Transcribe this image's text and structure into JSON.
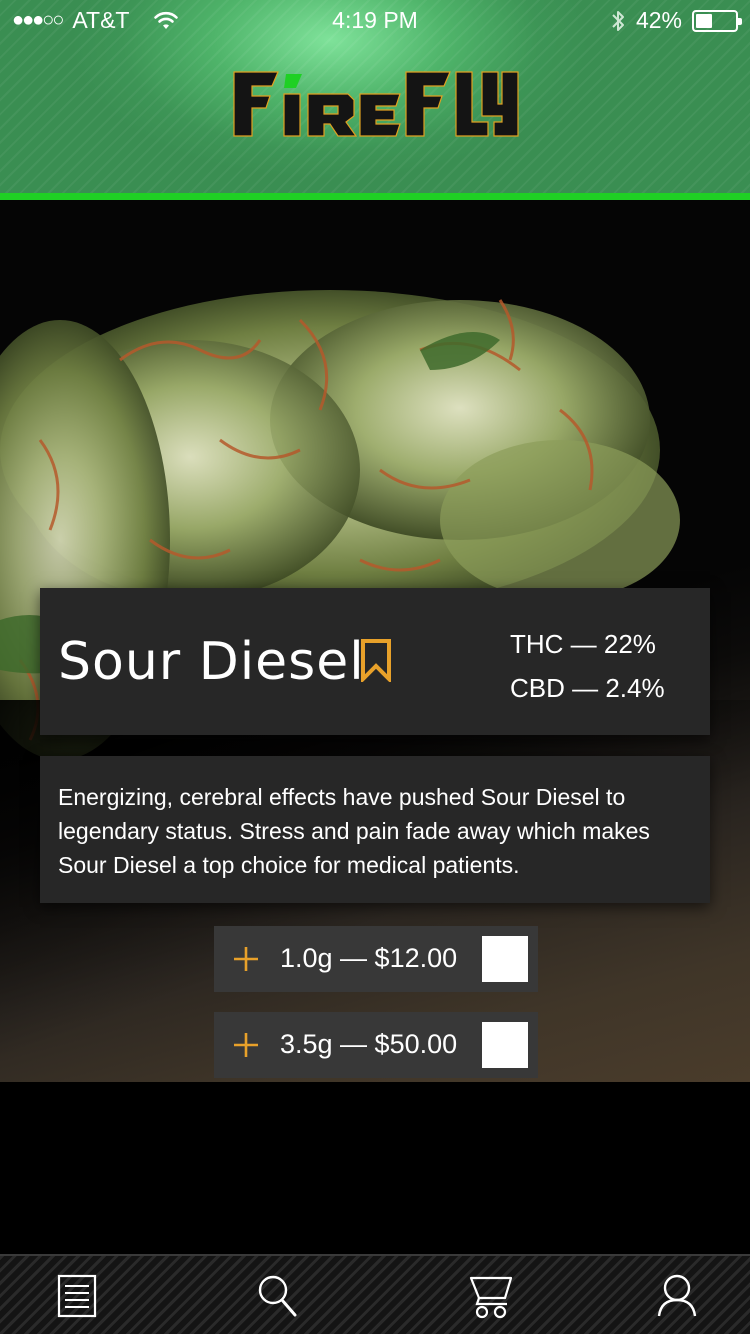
{
  "status_bar": {
    "signal": "●●●○○",
    "carrier": "AT&T",
    "time": "4:19 PM",
    "battery_percent": "42%",
    "battery_level": 0.42,
    "icons": [
      "wifi-icon",
      "bluetooth-icon",
      "battery-icon"
    ]
  },
  "header": {
    "brand": "FIREFLY",
    "brand_colors": {
      "primary": "#111111",
      "accent": "#1fd024",
      "trim": "#e0a020"
    },
    "background_color": "#4fb46a",
    "divider_color": "#1fd024"
  },
  "product": {
    "name": "Sour Diesel",
    "bookmark_icon": "bookmark-icon",
    "thc": "THC — 22%",
    "cbd": "CBD — 2.4%",
    "description": "Energizing, cerebral effects have pushed Sour Diesel to legendary status. Stress and pain fade away which makes Sour Diesel a top choice for medical patients.",
    "image": "cannabis-bud-photo"
  },
  "price_options": [
    {
      "label": "1.0g — $12.00",
      "icon": "plus-icon",
      "checked": false
    },
    {
      "label": "3.5g — $50.00",
      "icon": "plus-icon",
      "checked": false
    }
  ],
  "accent_color": "#e8a12a",
  "tab_bar": {
    "tabs": [
      {
        "icon": "menu-list-icon"
      },
      {
        "icon": "search-icon"
      },
      {
        "icon": "cart-icon"
      },
      {
        "icon": "profile-icon"
      }
    ]
  }
}
